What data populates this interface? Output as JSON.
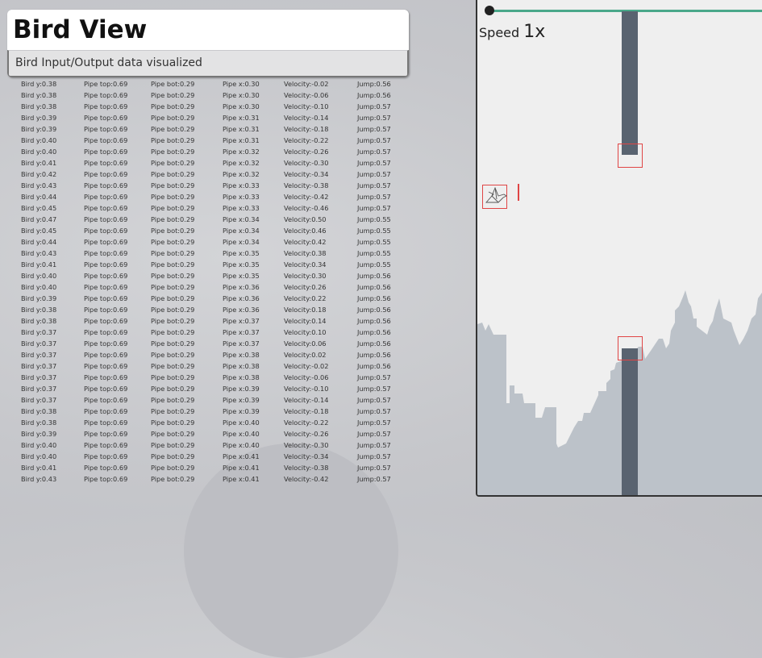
{
  "header": {
    "title": "Bird View",
    "subtitle": "Bird Input/Output data visualized"
  },
  "game": {
    "speed_label": "Speed",
    "speed_value": "1x",
    "colors": {
      "pipe": "#596370",
      "hitbox": "#e04545",
      "skyline": "#bcc2c9",
      "progress": "#4aa88a"
    }
  },
  "rows": [
    [
      "Bird y:0.38",
      "Pipe top:0.69",
      "Pipe bot:0.29",
      "Pipe x:0.30",
      "Velocity:-0.02",
      "Jump:0.56"
    ],
    [
      "Bird y:0.38",
      "Pipe top:0.69",
      "Pipe bot:0.29",
      "Pipe x:0.30",
      "Velocity:-0.06",
      "Jump:0.56"
    ],
    [
      "Bird y:0.38",
      "Pipe top:0.69",
      "Pipe bot:0.29",
      "Pipe x:0.30",
      "Velocity:-0.10",
      "Jump:0.57"
    ],
    [
      "Bird y:0.39",
      "Pipe top:0.69",
      "Pipe bot:0.29",
      "Pipe x:0.31",
      "Velocity:-0.14",
      "Jump:0.57"
    ],
    [
      "Bird y:0.39",
      "Pipe top:0.69",
      "Pipe bot:0.29",
      "Pipe x:0.31",
      "Velocity:-0.18",
      "Jump:0.57"
    ],
    [
      "Bird y:0.40",
      "Pipe top:0.69",
      "Pipe bot:0.29",
      "Pipe x:0.31",
      "Velocity:-0.22",
      "Jump:0.57"
    ],
    [
      "Bird y:0.40",
      "Pipe top:0.69",
      "Pipe bot:0.29",
      "Pipe x:0.32",
      "Velocity:-0.26",
      "Jump:0.57"
    ],
    [
      "Bird y:0.41",
      "Pipe top:0.69",
      "Pipe bot:0.29",
      "Pipe x:0.32",
      "Velocity:-0.30",
      "Jump:0.57"
    ],
    [
      "Bird y:0.42",
      "Pipe top:0.69",
      "Pipe bot:0.29",
      "Pipe x:0.32",
      "Velocity:-0.34",
      "Jump:0.57"
    ],
    [
      "Bird y:0.43",
      "Pipe top:0.69",
      "Pipe bot:0.29",
      "Pipe x:0.33",
      "Velocity:-0.38",
      "Jump:0.57"
    ],
    [
      "Bird y:0.44",
      "Pipe top:0.69",
      "Pipe bot:0.29",
      "Pipe x:0.33",
      "Velocity:-0.42",
      "Jump:0.57"
    ],
    [
      "Bird y:0.45",
      "Pipe top:0.69",
      "Pipe bot:0.29",
      "Pipe x:0.33",
      "Velocity:-0.46",
      "Jump:0.57"
    ],
    [
      "Bird y:0.47",
      "Pipe top:0.69",
      "Pipe bot:0.29",
      "Pipe x:0.34",
      "Velocity:0.50",
      "Jump:0.55"
    ],
    [
      "Bird y:0.45",
      "Pipe top:0.69",
      "Pipe bot:0.29",
      "Pipe x:0.34",
      "Velocity:0.46",
      "Jump:0.55"
    ],
    [
      "Bird y:0.44",
      "Pipe top:0.69",
      "Pipe bot:0.29",
      "Pipe x:0.34",
      "Velocity:0.42",
      "Jump:0.55"
    ],
    [
      "Bird y:0.43",
      "Pipe top:0.69",
      "Pipe bot:0.29",
      "Pipe x:0.35",
      "Velocity:0.38",
      "Jump:0.55"
    ],
    [
      "Bird y:0.41",
      "Pipe top:0.69",
      "Pipe bot:0.29",
      "Pipe x:0.35",
      "Velocity:0.34",
      "Jump:0.55"
    ],
    [
      "Bird y:0.40",
      "Pipe top:0.69",
      "Pipe bot:0.29",
      "Pipe x:0.35",
      "Velocity:0.30",
      "Jump:0.56"
    ],
    [
      "Bird y:0.40",
      "Pipe top:0.69",
      "Pipe bot:0.29",
      "Pipe x:0.36",
      "Velocity:0.26",
      "Jump:0.56"
    ],
    [
      "Bird y:0.39",
      "Pipe top:0.69",
      "Pipe bot:0.29",
      "Pipe x:0.36",
      "Velocity:0.22",
      "Jump:0.56"
    ],
    [
      "Bird y:0.38",
      "Pipe top:0.69",
      "Pipe bot:0.29",
      "Pipe x:0.36",
      "Velocity:0.18",
      "Jump:0.56"
    ],
    [
      "Bird y:0.38",
      "Pipe top:0.69",
      "Pipe bot:0.29",
      "Pipe x:0.37",
      "Velocity:0.14",
      "Jump:0.56"
    ],
    [
      "Bird y:0.37",
      "Pipe top:0.69",
      "Pipe bot:0.29",
      "Pipe x:0.37",
      "Velocity:0.10",
      "Jump:0.56"
    ],
    [
      "Bird y:0.37",
      "Pipe top:0.69",
      "Pipe bot:0.29",
      "Pipe x:0.37",
      "Velocity:0.06",
      "Jump:0.56"
    ],
    [
      "Bird y:0.37",
      "Pipe top:0.69",
      "Pipe bot:0.29",
      "Pipe x:0.38",
      "Velocity:0.02",
      "Jump:0.56"
    ],
    [
      "Bird y:0.37",
      "Pipe top:0.69",
      "Pipe bot:0.29",
      "Pipe x:0.38",
      "Velocity:-0.02",
      "Jump:0.56"
    ],
    [
      "Bird y:0.37",
      "Pipe top:0.69",
      "Pipe bot:0.29",
      "Pipe x:0.38",
      "Velocity:-0.06",
      "Jump:0.57"
    ],
    [
      "Bird y:0.37",
      "Pipe top:0.69",
      "Pipe bot:0.29",
      "Pipe x:0.39",
      "Velocity:-0.10",
      "Jump:0.57"
    ],
    [
      "Bird y:0.37",
      "Pipe top:0.69",
      "Pipe bot:0.29",
      "Pipe x:0.39",
      "Velocity:-0.14",
      "Jump:0.57"
    ],
    [
      "Bird y:0.38",
      "Pipe top:0.69",
      "Pipe bot:0.29",
      "Pipe x:0.39",
      "Velocity:-0.18",
      "Jump:0.57"
    ],
    [
      "Bird y:0.38",
      "Pipe top:0.69",
      "Pipe bot:0.29",
      "Pipe x:0.40",
      "Velocity:-0.22",
      "Jump:0.57"
    ],
    [
      "Bird y:0.39",
      "Pipe top:0.69",
      "Pipe bot:0.29",
      "Pipe x:0.40",
      "Velocity:-0.26",
      "Jump:0.57"
    ],
    [
      "Bird y:0.40",
      "Pipe top:0.69",
      "Pipe bot:0.29",
      "Pipe x:0.40",
      "Velocity:-0.30",
      "Jump:0.57"
    ],
    [
      "Bird y:0.40",
      "Pipe top:0.69",
      "Pipe bot:0.29",
      "Pipe x:0.41",
      "Velocity:-0.34",
      "Jump:0.57"
    ],
    [
      "Bird y:0.41",
      "Pipe top:0.69",
      "Pipe bot:0.29",
      "Pipe x:0.41",
      "Velocity:-0.38",
      "Jump:0.57"
    ],
    [
      "Bird y:0.43",
      "Pipe top:0.69",
      "Pipe bot:0.29",
      "Pipe x:0.41",
      "Velocity:-0.42",
      "Jump:0.57"
    ]
  ]
}
